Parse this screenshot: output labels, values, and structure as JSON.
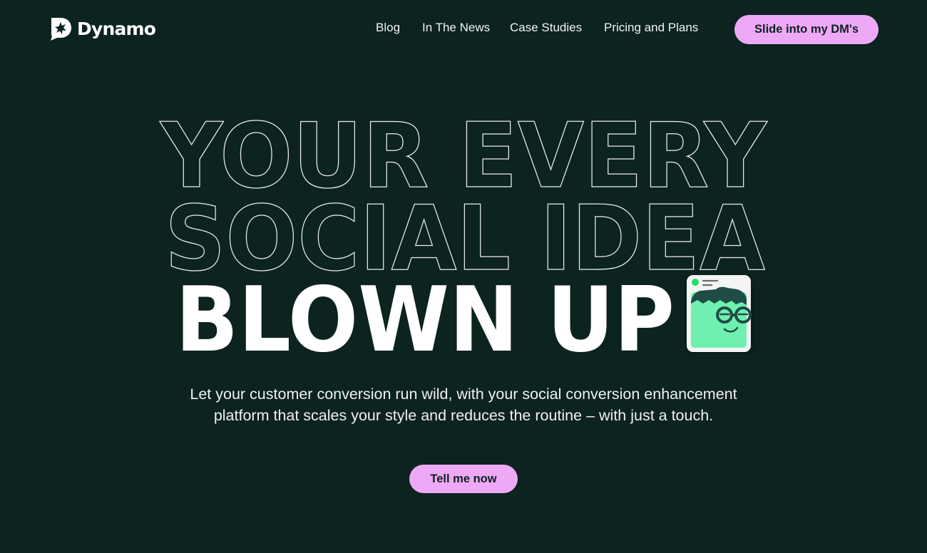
{
  "brand": {
    "name": "Dynamo"
  },
  "nav": {
    "items": [
      {
        "label": "Blog"
      },
      {
        "label": "In The News"
      },
      {
        "label": "Case Studies"
      },
      {
        "label": "Pricing and Plans"
      }
    ],
    "cta_label": "Slide into my DM's"
  },
  "hero": {
    "line1": "YOUR EVERY",
    "line2": "SOCIAL IDEA",
    "line3": "BLOWN UP",
    "subtitle_line1": "Let your customer conversion run wild, with your social conversion enhancement",
    "subtitle_line2": "platform that scales your style and reduces the routine – with just a touch.",
    "cta_label": "Tell me now"
  },
  "colors": {
    "background": "#0c2320",
    "accent_pink": "#eea9f6",
    "mascot_green": "#6ff0b0",
    "status_dot": "#22dd66"
  }
}
